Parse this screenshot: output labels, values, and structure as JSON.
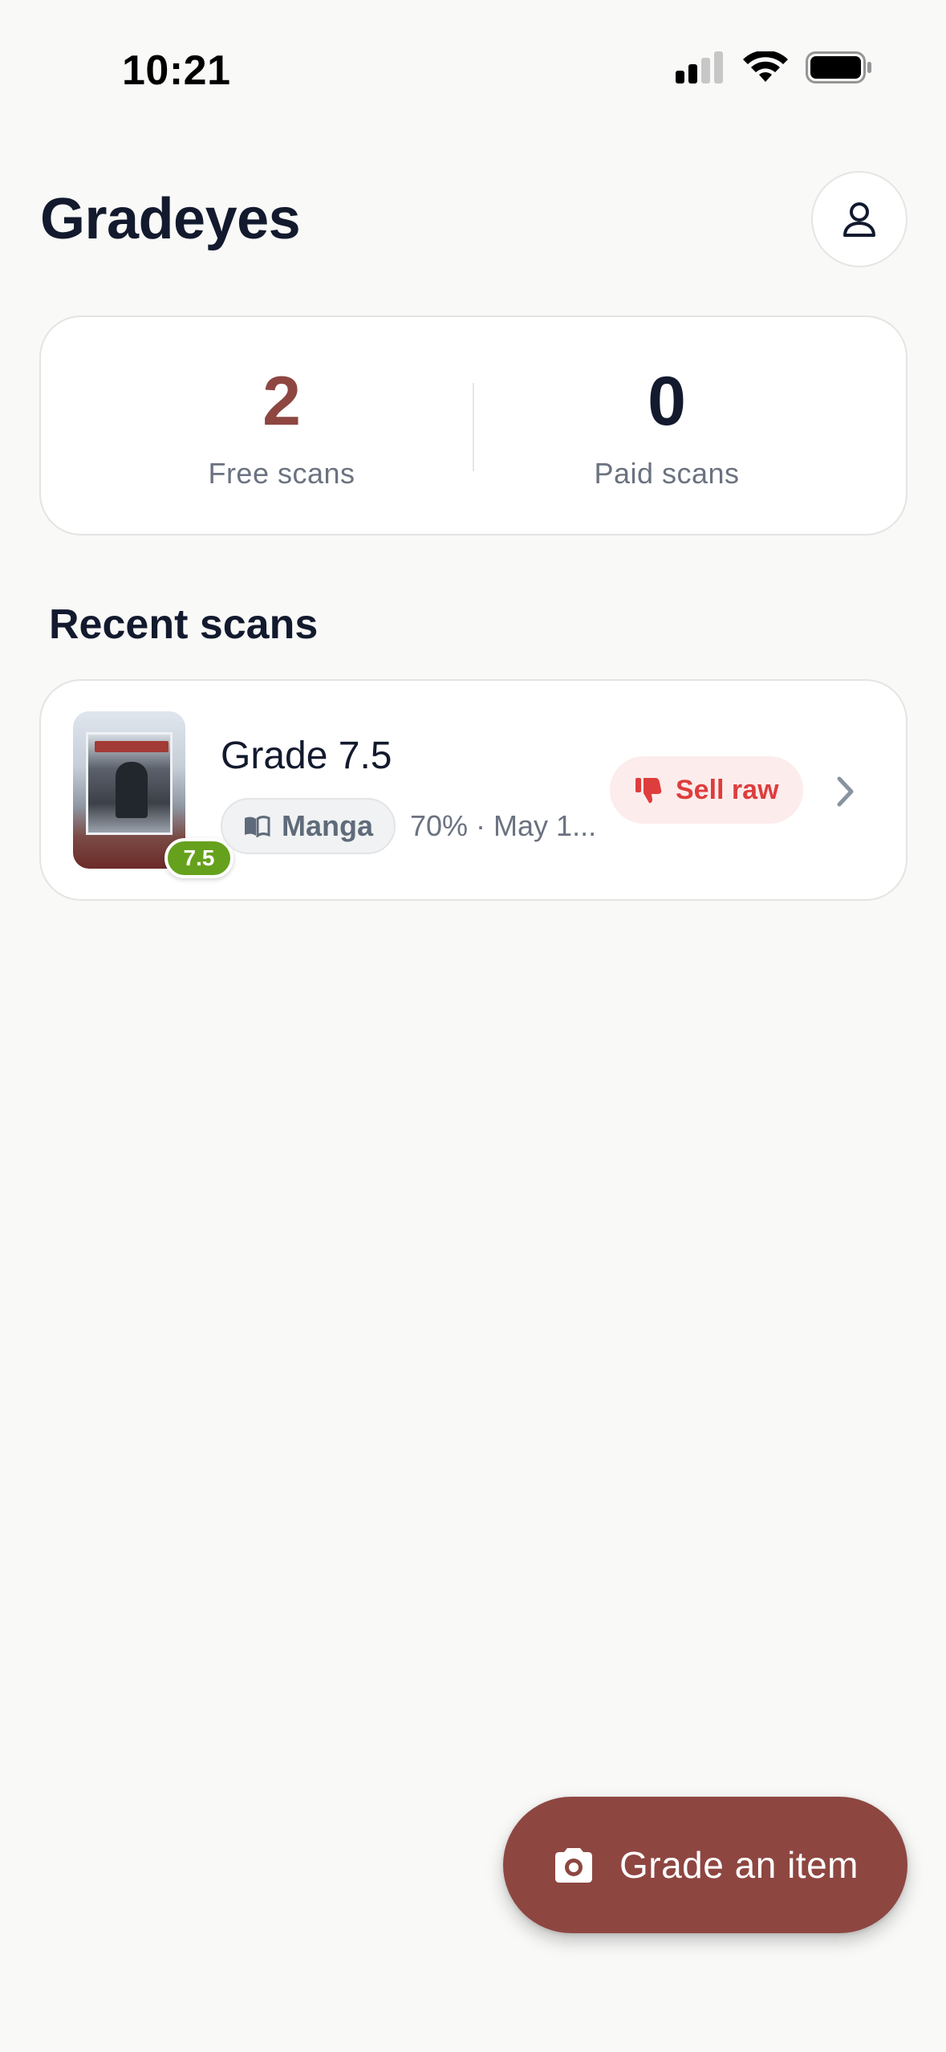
{
  "status_bar": {
    "time": "10:21"
  },
  "header": {
    "title": "Gradeyes"
  },
  "stats": {
    "free_value": "2",
    "free_label": "Free scans",
    "paid_value": "0",
    "paid_label": "Paid scans"
  },
  "recent": {
    "title": "Recent scans",
    "items": [
      {
        "title": "Grade 7.5",
        "badge": "7.5",
        "category": "Manga",
        "meta": "70% · May 1...",
        "verdict": "Sell raw"
      }
    ]
  },
  "fab": {
    "label": "Grade an item"
  },
  "colors": {
    "brand": "#8e4641",
    "grade_badge": "#66a11d",
    "verdict_text": "#de3d3d",
    "verdict_bg": "#fdecec"
  }
}
